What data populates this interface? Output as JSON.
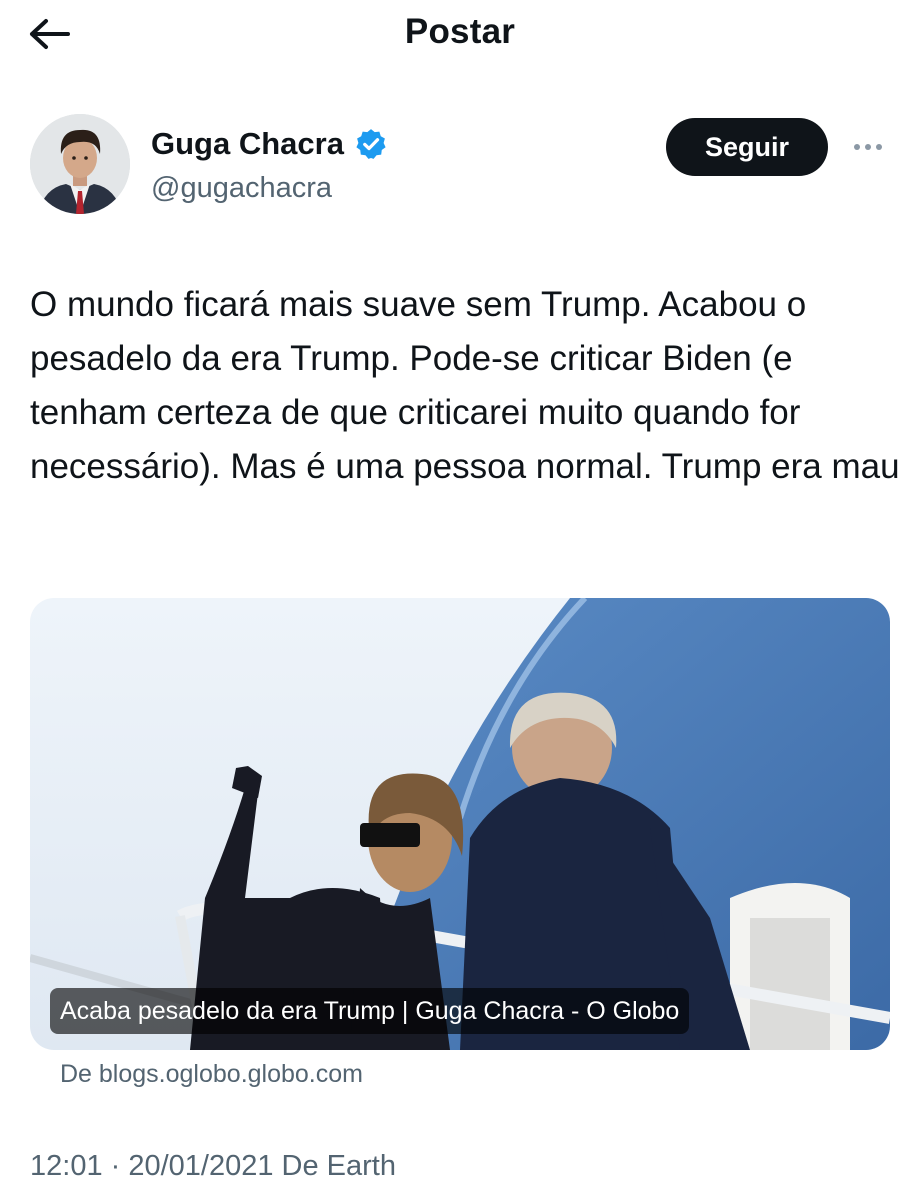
{
  "header": {
    "back_icon": "arrow-left-icon",
    "title": "Postar"
  },
  "author": {
    "name": "Guga Chacra",
    "verified_icon": "verified-badge-icon",
    "verified_color": "#1d9bf0",
    "handle": "@gugachacra",
    "follow_label": "Seguir",
    "more_icon": "more-horizontal-icon"
  },
  "post": {
    "text": "O mundo ficará mais suave sem Trump. Acabou o pesadelo da era Trump. Pode-se criticar Biden (e tenham certeza de que criticarei muito quando for necessário). Mas é uma pessoa normal. Trump era mau"
  },
  "link_card": {
    "caption": "Acaba pesadelo da era Trump | Guga Chacra - O Globo",
    "source": "De blogs.oglobo.globo.com"
  },
  "meta": {
    "timestamp": "12:01 · 20/01/2021 De Earth"
  },
  "colors": {
    "text_primary": "#0f1419",
    "text_secondary": "#536471",
    "button_dark": "#0f1419"
  }
}
